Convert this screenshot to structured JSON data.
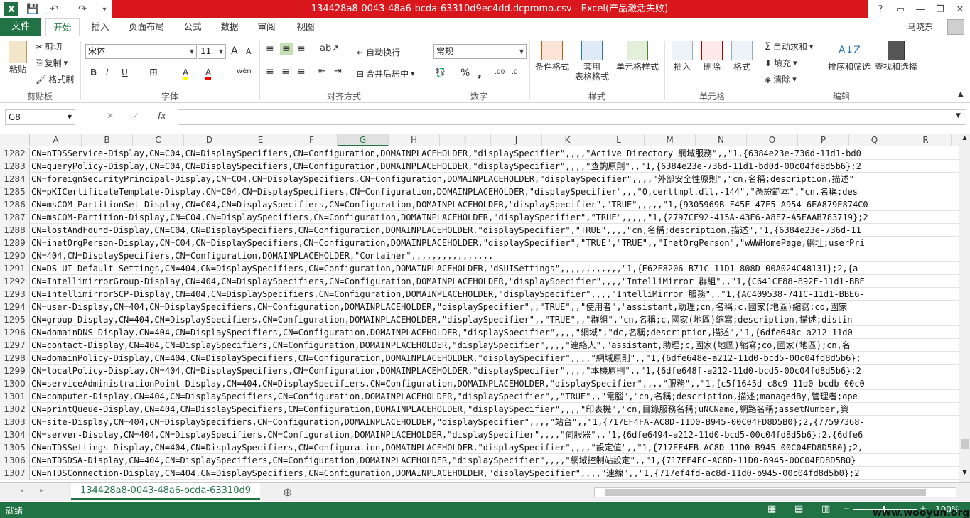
{
  "titlebar": {
    "title": "134428a8-0043-48a6-bcda-63310d9ec4dd.dcpromo.csv - Excel(产品激活失败)",
    "help": "?",
    "restore_ribbon": "▭",
    "minimize": "—",
    "maximize": "❐",
    "close": "✕"
  },
  "quick_access": {
    "excel_logo": "X",
    "save": "💾",
    "undo": "↶",
    "redo": "↷",
    "customize": "▾"
  },
  "tabs": {
    "file": "文件",
    "items": [
      "开始",
      "插入",
      "页面布局",
      "公式",
      "数据",
      "审阅",
      "视图"
    ],
    "active": "开始",
    "user": "马晓东"
  },
  "ribbon": {
    "clipboard": {
      "paste": "粘贴",
      "cut": "剪切",
      "copy": "复制",
      "format_painter": "格式刷",
      "label": "剪贴板"
    },
    "font": {
      "name": "宋体",
      "size": "11",
      "grow": "A",
      "shrink": "A",
      "bold": "B",
      "italic": "I",
      "underline": "U",
      "border": "⊞",
      "fill": "A",
      "color": "A",
      "wen": "wén",
      "label": "字体"
    },
    "alignment": {
      "wrap": "自动换行",
      "merge": "合并后居中",
      "label": "对齐方式"
    },
    "number": {
      "format": "常规",
      "currency": "💱",
      "percent": "%",
      "comma": ",",
      "inc_dec": ".00",
      "dec_dec": ".0",
      "label": "数字"
    },
    "styles": {
      "conditional": "条件格式",
      "table_line1": "套用",
      "table_line2": "表格格式",
      "cell_styles": "单元格样式",
      "label": "样式"
    },
    "cells": {
      "insert": "插入",
      "delete": "删除",
      "format": "格式",
      "label": "单元格"
    },
    "editing": {
      "autosum": "自动求和",
      "fill": "填充",
      "clear": "清除",
      "sort": "排序和筛选",
      "find": "查找和选择",
      "label": "编辑"
    }
  },
  "formula_bar": {
    "name_box": "G8",
    "cancel": "✕",
    "enter": "✓",
    "fx": "fx",
    "value": ""
  },
  "columns": [
    "A",
    "B",
    "C",
    "D",
    "E",
    "F",
    "G",
    "H",
    "I",
    "J",
    "K",
    "L",
    "M",
    "N",
    "O",
    "P",
    "Q",
    "R"
  ],
  "selected_column": "G",
  "rows": [
    {
      "num": "1282",
      "text": "CN=nTDSService-Display,CN=C04,CN=DisplaySpecifiers,CN=Configuration,DOMAINPLACEHOLDER,\"displaySpecifier\",,,,\"Active Directory 網域服務\",,\"1,{6384e23e-736d-11d1-bd0"
    },
    {
      "num": "1283",
      "text": "CN=queryPolicy-Display,CN=C04,CN=DisplaySpecifiers,CN=Configuration,DOMAINPLACEHOLDER,\"displaySpecifier\",,,,\"查詢原則\",,\"1,{6384e23e-736d-11d1-bd0d-00c04fd8d5b6};2"
    },
    {
      "num": "1284",
      "text": "CN=foreignSecurityPrincipal-Display,CN=C04,CN=DisplaySpecifiers,CN=Configuration,DOMAINPLACEHOLDER,\"displaySpecifier\",,,,\"外部安全性原則\",\"cn,名稱;description,描述\""
    },
    {
      "num": "1285",
      "text": "CN=pKICertificateTemplate-Display,CN=C04,CN=DisplaySpecifiers,CN=Configuration,DOMAINPLACEHOLDER,\"displaySpecifier\",,,\"0,certtmpl.dll,-144\",\"憑證範本\",\"cn,名稱;des"
    },
    {
      "num": "1286",
      "text": "CN=msCOM-PartitionSet-Display,CN=C04,CN=DisplaySpecifiers,CN=Configuration,DOMAINPLACEHOLDER,\"displaySpecifier\",\"TRUE\",,,,,\"1,{9305969B-F45F-47E5-A954-6EA879E874C0"
    },
    {
      "num": "1287",
      "text": "CN=msCOM-Partition-Display,CN=C04,CN=DisplaySpecifiers,CN=Configuration,DOMAINPLACEHOLDER,\"displaySpecifier\",\"TRUE\",,,,,\"1,{2797CF92-415A-43E6-A8F7-A5FAAB783719};2"
    },
    {
      "num": "1288",
      "text": "CN=lostAndFound-Display,CN=C04,CN=DisplaySpecifiers,CN=Configuration,DOMAINPLACEHOLDER,\"displaySpecifier\",\"TRUE\",,,,\"cn,名稱;description,描述\",\"1,{6384e23e-736d-11"
    },
    {
      "num": "1289",
      "text": "CN=inetOrgPerson-Display,CN=C04,CN=DisplaySpecifiers,CN=Configuration,DOMAINPLACEHOLDER,\"displaySpecifier\",\"TRUE\",\"TRUE\",,\"InetOrgPerson\",\"wWWHomePage,網址;userPri"
    },
    {
      "num": "1290",
      "text": "CN=404,CN=DisplaySpecifiers,CN=Configuration,DOMAINPLACEHOLDER,\"Container\",,,,,,,,,,,,,,,,"
    },
    {
      "num": "1291",
      "text": "CN=DS-UI-Default-Settings,CN=404,CN=DisplaySpecifiers,CN=Configuration,DOMAINPLACEHOLDER,\"dSUISettings\",,,,,,,,,,,,\"1,{E62F8206-B71C-11D1-808D-00A024C48131};2,{a"
    },
    {
      "num": "1292",
      "text": "CN=IntellimirrorGroup-Display,CN=404,CN=DisplaySpecifiers,CN=Configuration,DOMAINPLACEHOLDER,\"displaySpecifier\",,,,\"IntelliMirror 群組\",,\"1,{C641CF88-892F-11d1-BBE"
    },
    {
      "num": "1293",
      "text": "CN=IntellimirrorSCP-Display,CN=404,CN=DisplaySpecifiers,CN=Configuration,DOMAINPLACEHOLDER,\"displaySpecifier\",,,,\"IntelliMirror 服務\",,\"1,{AC409538-741C-11d1-BBE6-"
    },
    {
      "num": "1294",
      "text": "CN=user-Display,CN=404,CN=DisplaySpecifiers,CN=Configuration,DOMAINPLACEHOLDER,\"displaySpecifier\",,\"TRUE\",,\"使用者\",\"assistant,助理;cn,名稱;c,國家(地區)縮寫;co,國家"
    },
    {
      "num": "1295",
      "text": "CN=group-Display,CN=404,CN=DisplaySpecifiers,CN=Configuration,DOMAINPLACEHOLDER,\"displaySpecifier\",,\"TRUE\",,\"群組\",\"cn,名稱;c,國家(地區)縮寫;description,描述;distin"
    },
    {
      "num": "1296",
      "text": "CN=domainDNS-Display,CN=404,CN=DisplaySpecifiers,CN=Configuration,DOMAINPLACEHOLDER,\"displaySpecifier\",,,,\"網域\",\"dc,名稱;description,描述\",\"1,{6dfe648c-a212-11d0-"
    },
    {
      "num": "1297",
      "text": "CN=contact-Display,CN=404,CN=DisplaySpecifiers,CN=Configuration,DOMAINPLACEHOLDER,\"displaySpecifier\",,,,\"連絡人\",\"assistant,助理;c,國家(地區)縮寫;co,國家(地區);cn,名"
    },
    {
      "num": "1298",
      "text": "CN=domainPolicy-Display,CN=404,CN=DisplaySpecifiers,CN=Configuration,DOMAINPLACEHOLDER,\"displaySpecifier\",,,,\"網域原則\",,\"1,{6dfe648e-a212-11d0-bcd5-00c04fd8d5b6};"
    },
    {
      "num": "1299",
      "text": "CN=localPolicy-Display,CN=404,CN=DisplaySpecifiers,CN=Configuration,DOMAINPLACEHOLDER,\"displaySpecifier\",,,,\"本機原則\",,\"1,{6dfe648f-a212-11d0-bcd5-00c04fd8d5b6};2"
    },
    {
      "num": "1300",
      "text": "CN=serviceAdministrationPoint-Display,CN=404,CN=DisplaySpecifiers,CN=Configuration,DOMAINPLACEHOLDER,\"displaySpecifier\",,,,\"服務\",,\"1,{c5f1645d-c8c9-11d0-bcdb-00c0"
    },
    {
      "num": "1301",
      "text": "CN=computer-Display,CN=404,CN=DisplaySpecifiers,CN=Configuration,DOMAINPLACEHOLDER,\"displaySpecifier\",,\"TRUE\",,\"電腦\",\"cn,名稱;description,描述;managedBy,管理者;ope"
    },
    {
      "num": "1302",
      "text": "CN=printQueue-Display,CN=404,CN=DisplaySpecifiers,CN=Configuration,DOMAINPLACEHOLDER,\"displaySpecifier\",,,,\"印表機\",\"cn,目錄服務名稱;uNCName,網路名稱;assetNumber,資"
    },
    {
      "num": "1303",
      "text": "CN=site-Display,CN=404,CN=DisplaySpecifiers,CN=Configuration,DOMAINPLACEHOLDER,\"displaySpecifier\",,,,\"站台\",,\"1,{717EF4FA-AC8D-11D0-B945-00C04FD8D5B0};2,{77597368-"
    },
    {
      "num": "1304",
      "text": "CN=server-Display,CN=404,CN=DisplaySpecifiers,CN=Configuration,DOMAINPLACEHOLDER,\"displaySpecifier\",,,,\"伺服器\",,\"1,{6dfe6494-a212-11d0-bcd5-00c04fd8d5b6};2,{6dfe6"
    },
    {
      "num": "1305",
      "text": "CN=nTDSSettings-Display,CN=404,CN=DisplaySpecifiers,CN=Configuration,DOMAINPLACEHOLDER,\"displaySpecifier\",,,,\"設定值\",,\"1,{717EF4FB-AC8D-11D0-B945-00C04FD8D5B0};2,"
    },
    {
      "num": "1306",
      "text": "CN=nTDSDSA-Display,CN=404,CN=DisplaySpecifiers,CN=Configuration,DOMAINPLACEHOLDER,\"displaySpecifier\",,,,\"網域控制站設定\",,\"1,{717EF4FC-AC8D-11D0-B945-00C04FD8D5B0}"
    },
    {
      "num": "1307",
      "text": "CN=nTDSConnection-Display,CN=404,CN=DisplaySpecifiers,CN=Configuration,DOMAINPLACEHOLDER,\"displaySpecifier\",,,,\"連線\",,\"1,{717ef4fd-ac8d-11d0-b945-00c04fd8d5b0};2"
    }
  ],
  "sheet": {
    "tab": "134428a8-0043-48a6-bcda-63310d9",
    "add": "⊕",
    "prev": "◂",
    "next": "▸"
  },
  "statusbar": {
    "status": "就绪",
    "zoom": "100%",
    "watermark": "www.wooyun.org"
  },
  "colors": {
    "excel_green": "#217346",
    "title_red": "#d9161c"
  }
}
